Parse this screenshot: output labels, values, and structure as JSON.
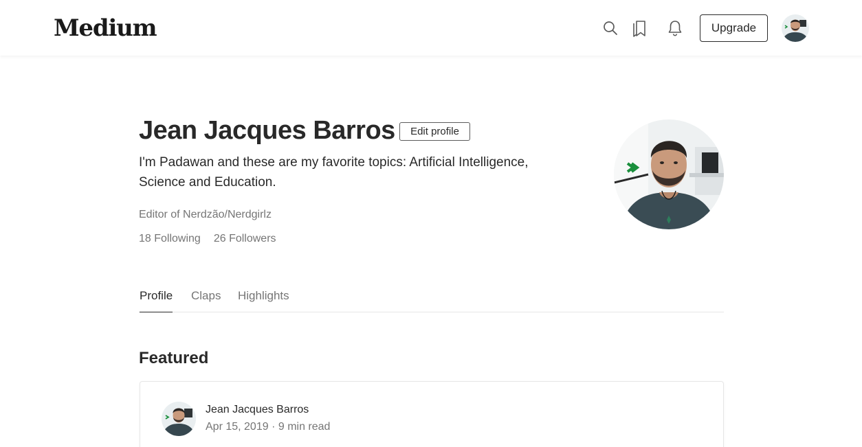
{
  "header": {
    "logo": "Medium",
    "upgrade_label": "Upgrade",
    "icons": [
      "search-icon",
      "bookmarks-icon",
      "bell-icon"
    ]
  },
  "profile": {
    "name": "Jean Jacques Barros",
    "edit_label": "Edit profile",
    "bio": "I'm Padawan and these are my favorite topics: Artificial Intelligence, Science and Education.",
    "editor_of": "Editor of Nerdzão/Nerdgirlz",
    "following": "18 Following",
    "followers": "26 Followers"
  },
  "tabs": [
    {
      "label": "Profile",
      "active": true
    },
    {
      "label": "Claps",
      "active": false
    },
    {
      "label": "Highlights",
      "active": false
    }
  ],
  "featured": {
    "title": "Featured",
    "author": "Jean Jacques Barros",
    "date": "Apr 15, 2019",
    "read_time": "9 min read"
  },
  "colors": {
    "text": "#292929",
    "muted": "#757575",
    "divider": "#e6e6e6",
    "brand_green": "#1a8f3c"
  }
}
